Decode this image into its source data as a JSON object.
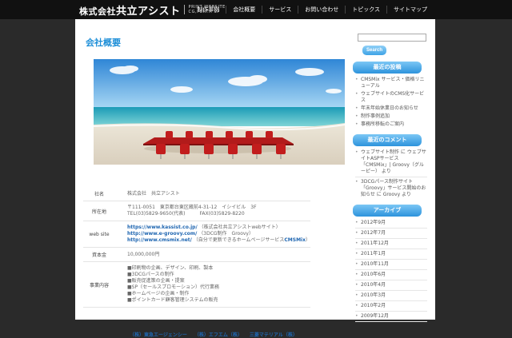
{
  "header": {
    "company_name_prefix": "株式会社",
    "company_name_main": "共立アシスト",
    "tagline_line1": "PRINT WEBSITE",
    "tagline_line2": "CG,PERTH SP",
    "nav": [
      "制作事例",
      "会社概要",
      "サービス",
      "お問い合わせ",
      "トピックス",
      "サイトマップ"
    ]
  },
  "main": {
    "page_title": "会社概要",
    "company_info": {
      "name_label": "社名",
      "name_value": "株式会社　共立アシスト",
      "address_label": "所在地",
      "address_line1": "〒111-0051　東京都台東区蔵前4-31-12　イシイビル　3F",
      "address_line2": "TEL(03)5829-9650(代表)　　　FAX(03)5829-8220",
      "website_label": "web site",
      "website1_url": "https://www.kassist.co.jp/",
      "website1_note": "（株式会社共立アシストwebサイト）",
      "website2_url": "http://www.e-groovy.com/",
      "website2_note": "（3DCG制作　Groovy）",
      "website3_url": "http://www.cmsmix.net/",
      "website3_note_a": "（自分で更新できるホームページサービス",
      "website3_note_b": "CMSMix",
      "website3_note_c": "）",
      "capital_label": "資本金",
      "capital_value": "10,000,000円",
      "business_label": "事業内容",
      "business_items": [
        "■印刷物の企画、デザイン、印刷、製本",
        "■3DCGパースの制作",
        "■販売促進策の企画・提案",
        "■SP（セールスプロモーション）代行業務",
        "■ホームページの企画・制作",
        "■ポイントカード顧客管理システムの販売"
      ]
    },
    "bottom_links": "（株）東急エージェンシー　　（株）エフエム（株）　　三菱マテリアル（株）"
  },
  "sidebar": {
    "search_button": "Search",
    "recent_posts_title": "最近の投稿",
    "recent_posts": [
      "CMSMix サービス・価格リニューアル",
      "ウェブサイトのCMS化サービス",
      "年末年始休業日のお知らせ",
      "制作事例追加",
      "事務所移転のご案内"
    ],
    "recent_comments_title": "最近のコメント",
    "recent_comments": [
      "ウェブサイト制作 に ウェブサイトASPサービス「CMSMix」| Groovy（グルーピー） より",
      "3DCGパース制作サイト「Groovy」サービス開始のお知らせ に Groovy より"
    ],
    "archive_title": "アーカイブ",
    "archives": [
      "2012年9月",
      "2012年7月",
      "2011年12月",
      "2011年1月",
      "2010年11月",
      "2010年6月",
      "2010年4月",
      "2010年3月",
      "2010年2月",
      "2009年12月"
    ]
  },
  "colors": {
    "accent": "#1e8fd8",
    "link": "#1f66b1",
    "header_bg": "#111111"
  }
}
